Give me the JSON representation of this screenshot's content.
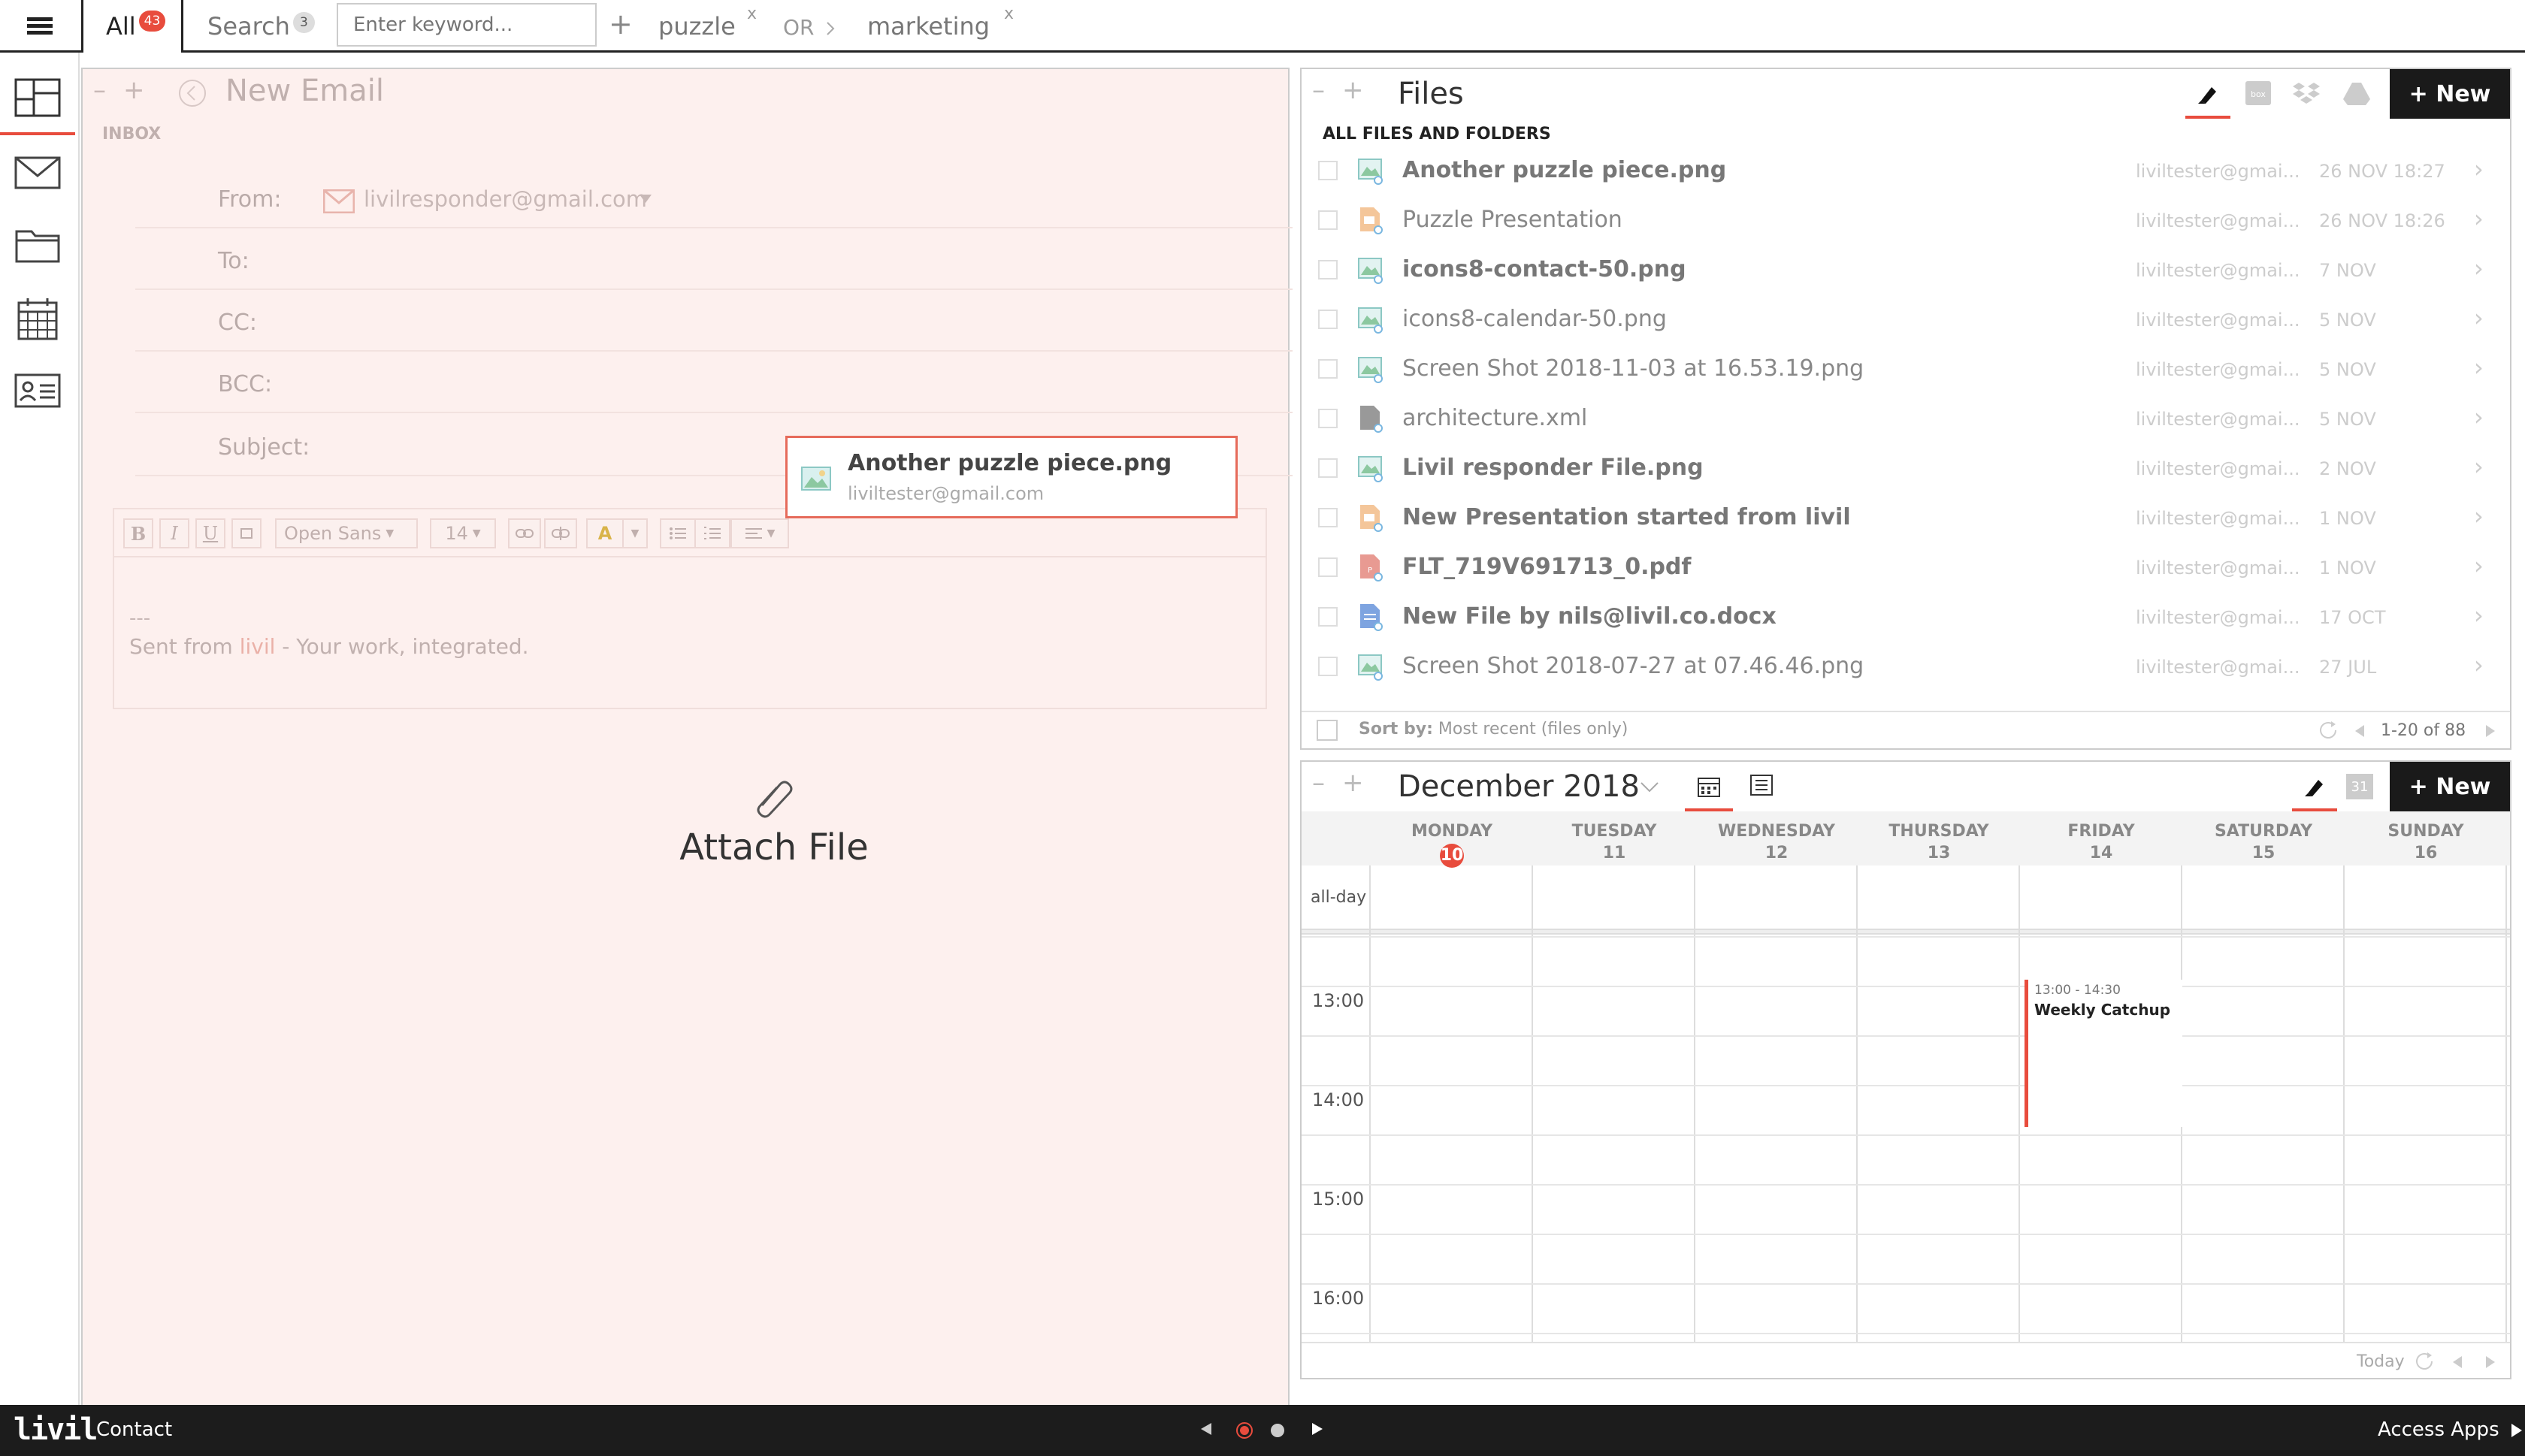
{
  "topbar": {
    "tab_all_label": "All",
    "tab_all_count": "43",
    "search_label": "Search",
    "search_count": "3",
    "keyword_placeholder": "Enter keyword...",
    "plus": "+",
    "term1": "puzzle",
    "or_label": "OR",
    "term2": "marketing",
    "remove": "x"
  },
  "email": {
    "title": "New Email",
    "inbox_label": "INBOX",
    "from_label": "From:",
    "from_value": "livilresponder@gmail.com",
    "to_label": "To:",
    "cc_label": "CC:",
    "bcc_label": "BCC:",
    "subject_label": "Subject:",
    "font_name": "Open Sans",
    "font_size": "14",
    "sig_dashes": "---",
    "sig_prefix": "Sent from ",
    "sig_link": "livil",
    "sig_suffix": " - Your work, integrated.",
    "attach_label": "Attach File",
    "drag_file_name": "Another puzzle piece.png",
    "drag_file_owner": "liviltester@gmail.com"
  },
  "files": {
    "title": "Files",
    "new_label": "+ New",
    "section_label": "ALL FILES AND FOLDERS",
    "sort_prefix": "Sort by:",
    "sort_value": "Most recent (files only)",
    "pagination": "1-20 of 88",
    "rows": [
      {
        "name": "Another puzzle piece.png",
        "owner": "liviltester@gmai...",
        "date": "26 NOV 18:27",
        "bold": true,
        "icon": "image"
      },
      {
        "name": "Puzzle Presentation",
        "owner": "liviltester@gmai...",
        "date": "26 NOV 18:26",
        "bold": false,
        "icon": "presentation"
      },
      {
        "name": "icons8-contact-50.png",
        "owner": "liviltester@gmai...",
        "date": "7 NOV",
        "bold": true,
        "icon": "image"
      },
      {
        "name": "icons8-calendar-50.png",
        "owner": "liviltester@gmai...",
        "date": "5 NOV",
        "bold": false,
        "icon": "image"
      },
      {
        "name": "Screen Shot 2018-11-03 at 16.53.19.png",
        "owner": "liviltester@gmai...",
        "date": "5 NOV",
        "bold": false,
        "icon": "image"
      },
      {
        "name": "architecture.xml",
        "owner": "liviltester@gmai...",
        "date": "5 NOV",
        "bold": false,
        "icon": "file"
      },
      {
        "name": "Livil responder File.png",
        "owner": "liviltester@gmai...",
        "date": "2 NOV",
        "bold": true,
        "icon": "image"
      },
      {
        "name": "New Presentation started from livil",
        "owner": "liviltester@gmai...",
        "date": "1 NOV",
        "bold": true,
        "icon": "presentation"
      },
      {
        "name": "FLT_719V691713_0.pdf",
        "owner": "liviltester@gmai...",
        "date": "1 NOV",
        "bold": true,
        "icon": "pdf"
      },
      {
        "name": "New File by nils@livil.co.docx",
        "owner": "liviltester@gmai...",
        "date": "17 OCT",
        "bold": true,
        "icon": "doc"
      },
      {
        "name": "Screen Shot 2018-07-27 at 07.46.46.png",
        "owner": "liviltester@gmai...",
        "date": "27 JUL",
        "bold": false,
        "icon": "image"
      }
    ]
  },
  "calendar": {
    "month_label": "December 2018",
    "new_label": "+ New",
    "date_icon_text": "31",
    "allday_label": "all-day",
    "days": [
      {
        "name": "MONDAY",
        "num": "10",
        "today": true
      },
      {
        "name": "TUESDAY",
        "num": "11",
        "today": false
      },
      {
        "name": "WEDNESDAY",
        "num": "12",
        "today": false
      },
      {
        "name": "THURSDAY",
        "num": "13",
        "today": false
      },
      {
        "name": "FRIDAY",
        "num": "14",
        "today": false
      },
      {
        "name": "SATURDAY",
        "num": "15",
        "today": false
      },
      {
        "name": "SUNDAY",
        "num": "16",
        "today": false
      }
    ],
    "times": [
      "13:00",
      "14:00",
      "15:00",
      "16:00"
    ],
    "event": {
      "time": "13:00 - 14:30",
      "title": "Weekly Catchup",
      "color": "#e84c3d"
    },
    "today_label": "Today"
  },
  "bottom": {
    "logo": "livil",
    "contact": "Contact",
    "access_apps": "Access Apps"
  },
  "colors": {
    "accent": "#e84c3d",
    "dark": "#1c1c1c",
    "email_bg": "#fdf0ee"
  }
}
